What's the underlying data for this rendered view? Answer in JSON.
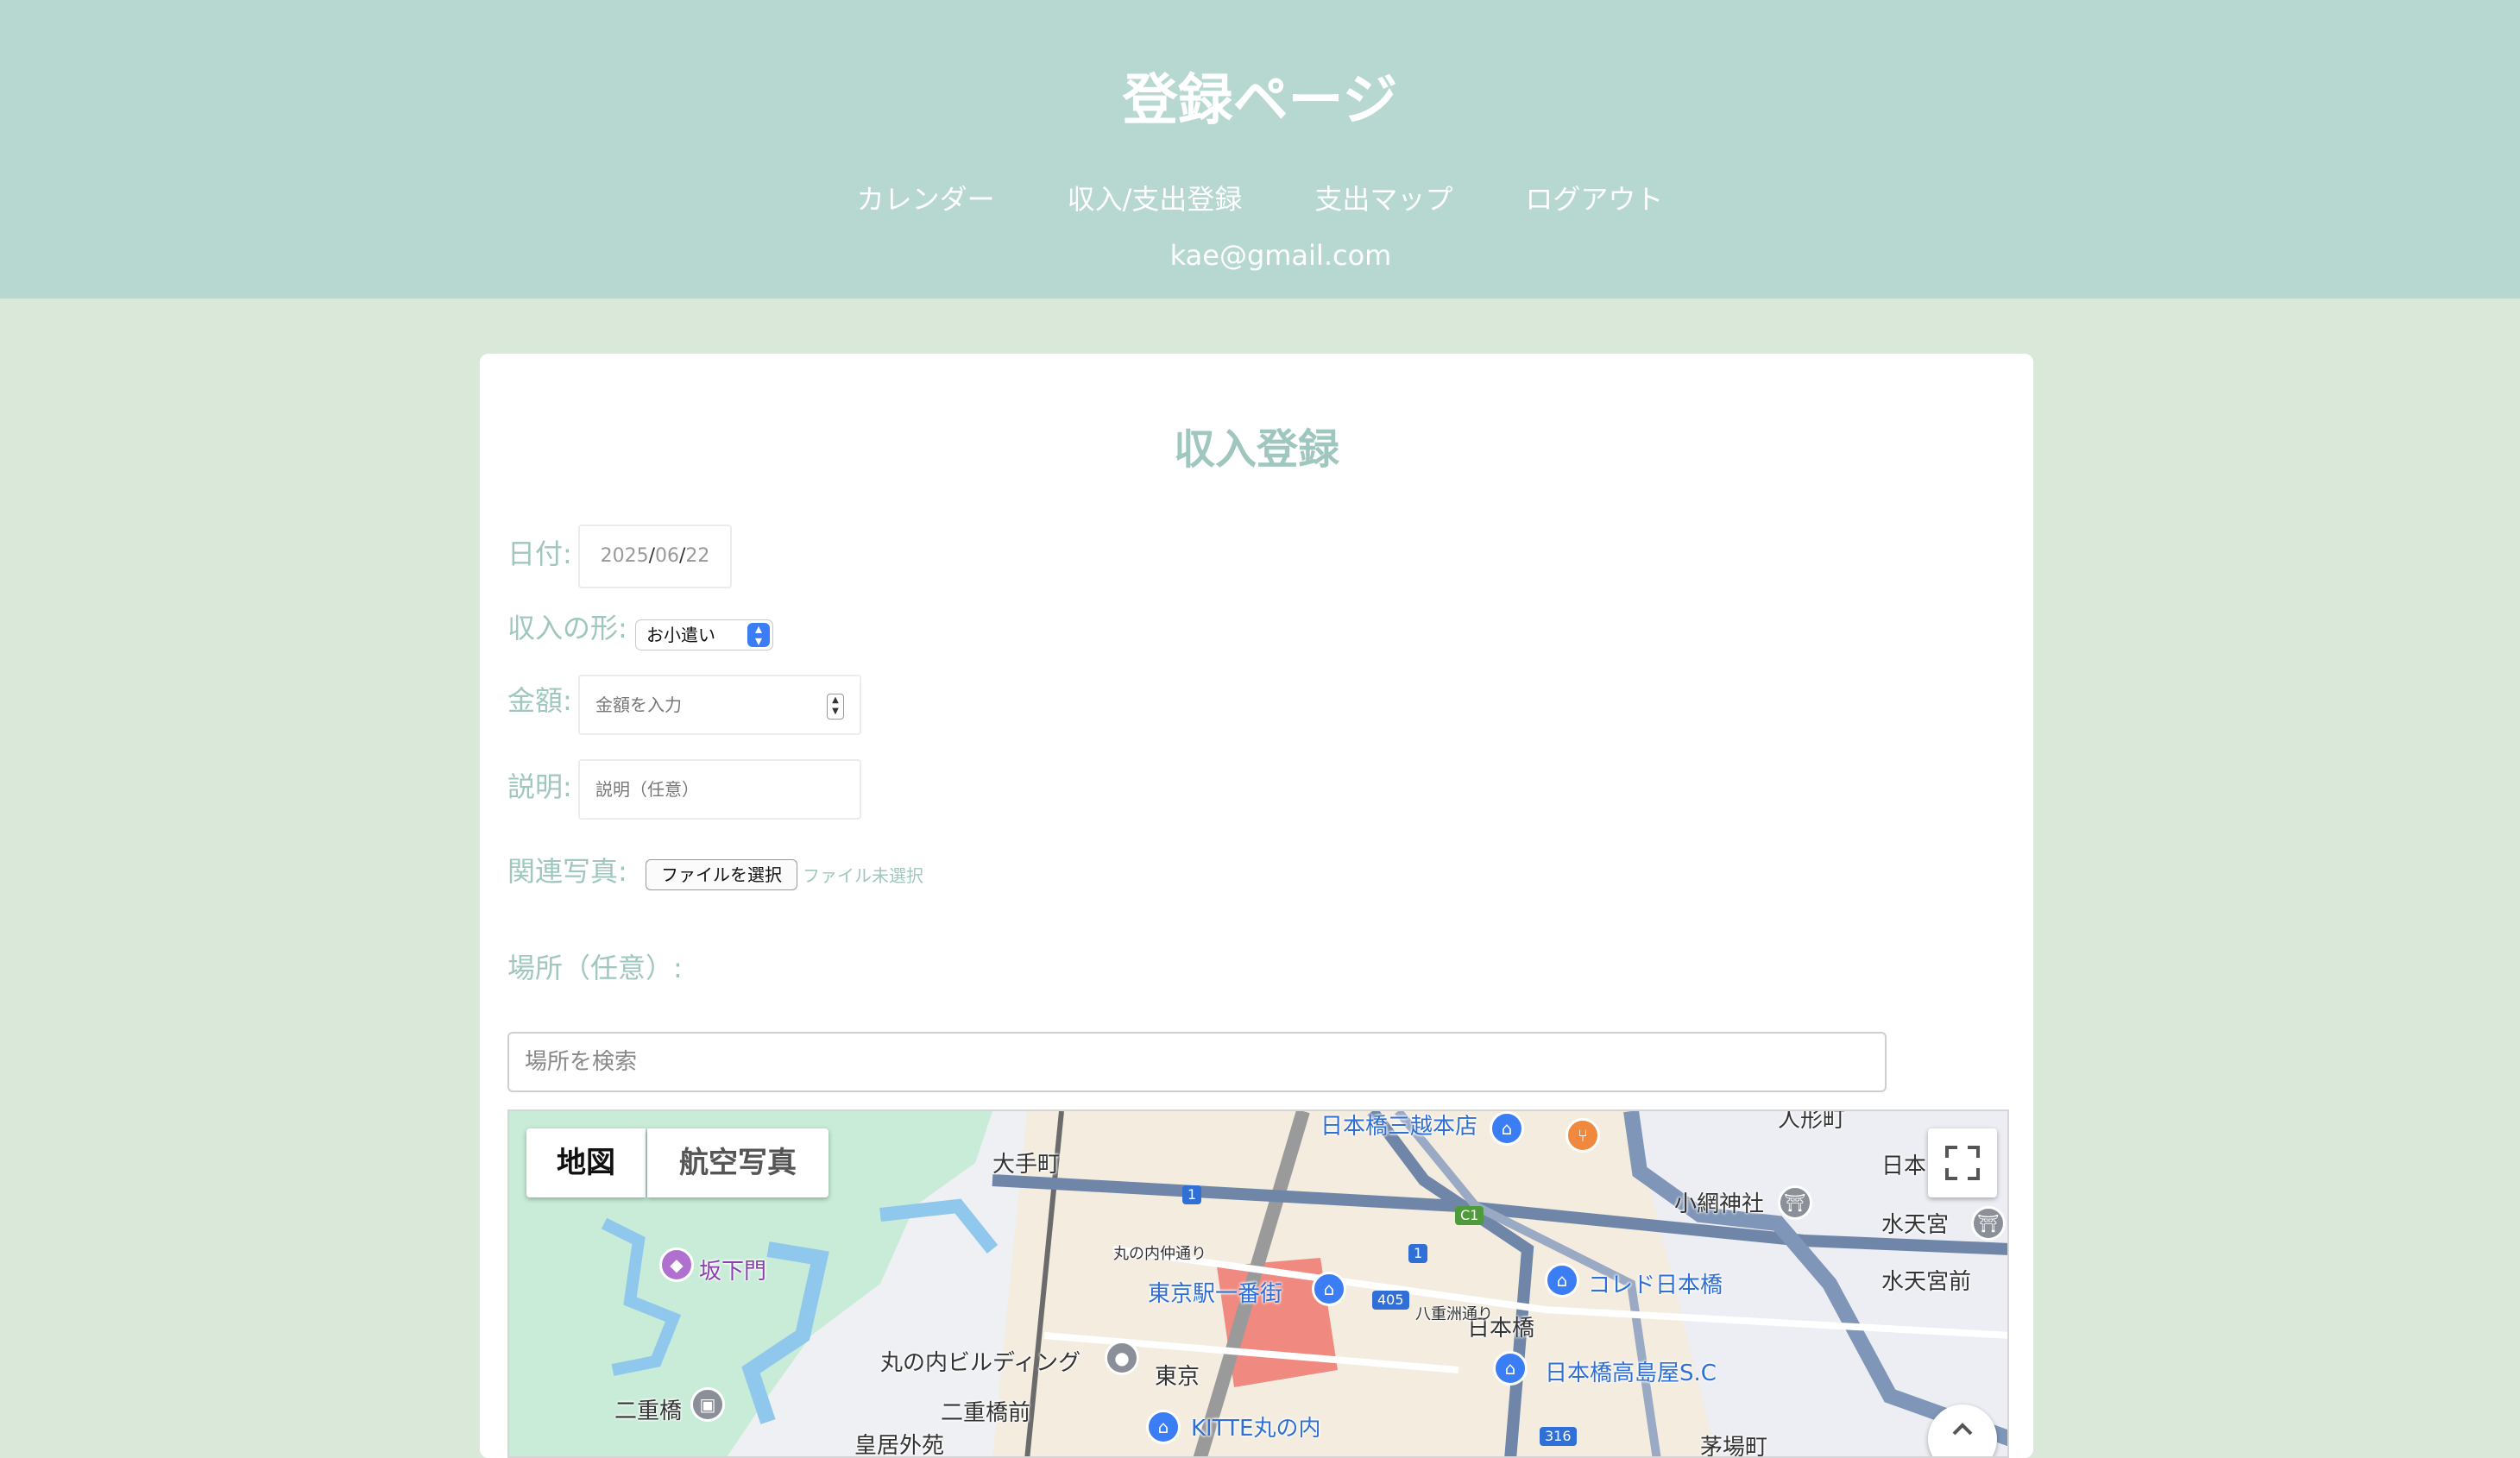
{
  "header": {
    "title": "登録ページ",
    "nav": [
      "カレンダー",
      "収入/支出登録",
      "支出マップ",
      "ログアウト"
    ],
    "email": "kae@gmail.com"
  },
  "form": {
    "title": "収入登録",
    "date_label": "日付:",
    "date_year": "2025",
    "date_month": "06",
    "date_day": "22",
    "sep": "/",
    "type_label": "収入の形:",
    "type_value": "お小遣い",
    "amount_label": "金額:",
    "amount_placeholder": "金額を入力",
    "desc_label": "説明:",
    "desc_placeholder": "説明（任意）",
    "photo_label": "関連写真:",
    "file_button": "ファイルを選択",
    "file_status": "ファイル未選択",
    "place_label": "場所（任意）:",
    "search_placeholder": "場所を検索"
  },
  "map": {
    "type_map": "地図",
    "type_satellite": "航空写真",
    "labels": {
      "otemachi": "大手町",
      "mitsukoshi": "日本橋三越本店",
      "ningyocho": "人形町",
      "nihon": "日本",
      "koami": "小網神社",
      "suitengu": "水天宮",
      "suitengumae": "水天宮前",
      "sakashita": "坂下門",
      "tokyo_ichibangai": "東京駅一番街",
      "coredo": "コレド日本橋",
      "nihonbashi": "日本橋",
      "marunouchi_bldg": "丸の内ビルディング",
      "tokyo": "東京",
      "takashimaya": "日本橋高島屋S.C",
      "nijubashi": "二重橋",
      "nijubashimae": "二重橋前",
      "kitte": "KITTE丸の内",
      "kokyo_gaien": "皇居外苑",
      "kayabacho": "茅場町",
      "marunouchi_st": "丸の内仲通り",
      "yaesu": "八重洲通り",
      "route_1": "1",
      "route_405": "405",
      "route_c1": "C1",
      "route_316": "316"
    }
  },
  "colors": {
    "header_bg": "#b7d8d0",
    "page_bg": "#d9e8d9",
    "accent_text": "#9fc7bf",
    "select_accent": "#3b7df5"
  }
}
